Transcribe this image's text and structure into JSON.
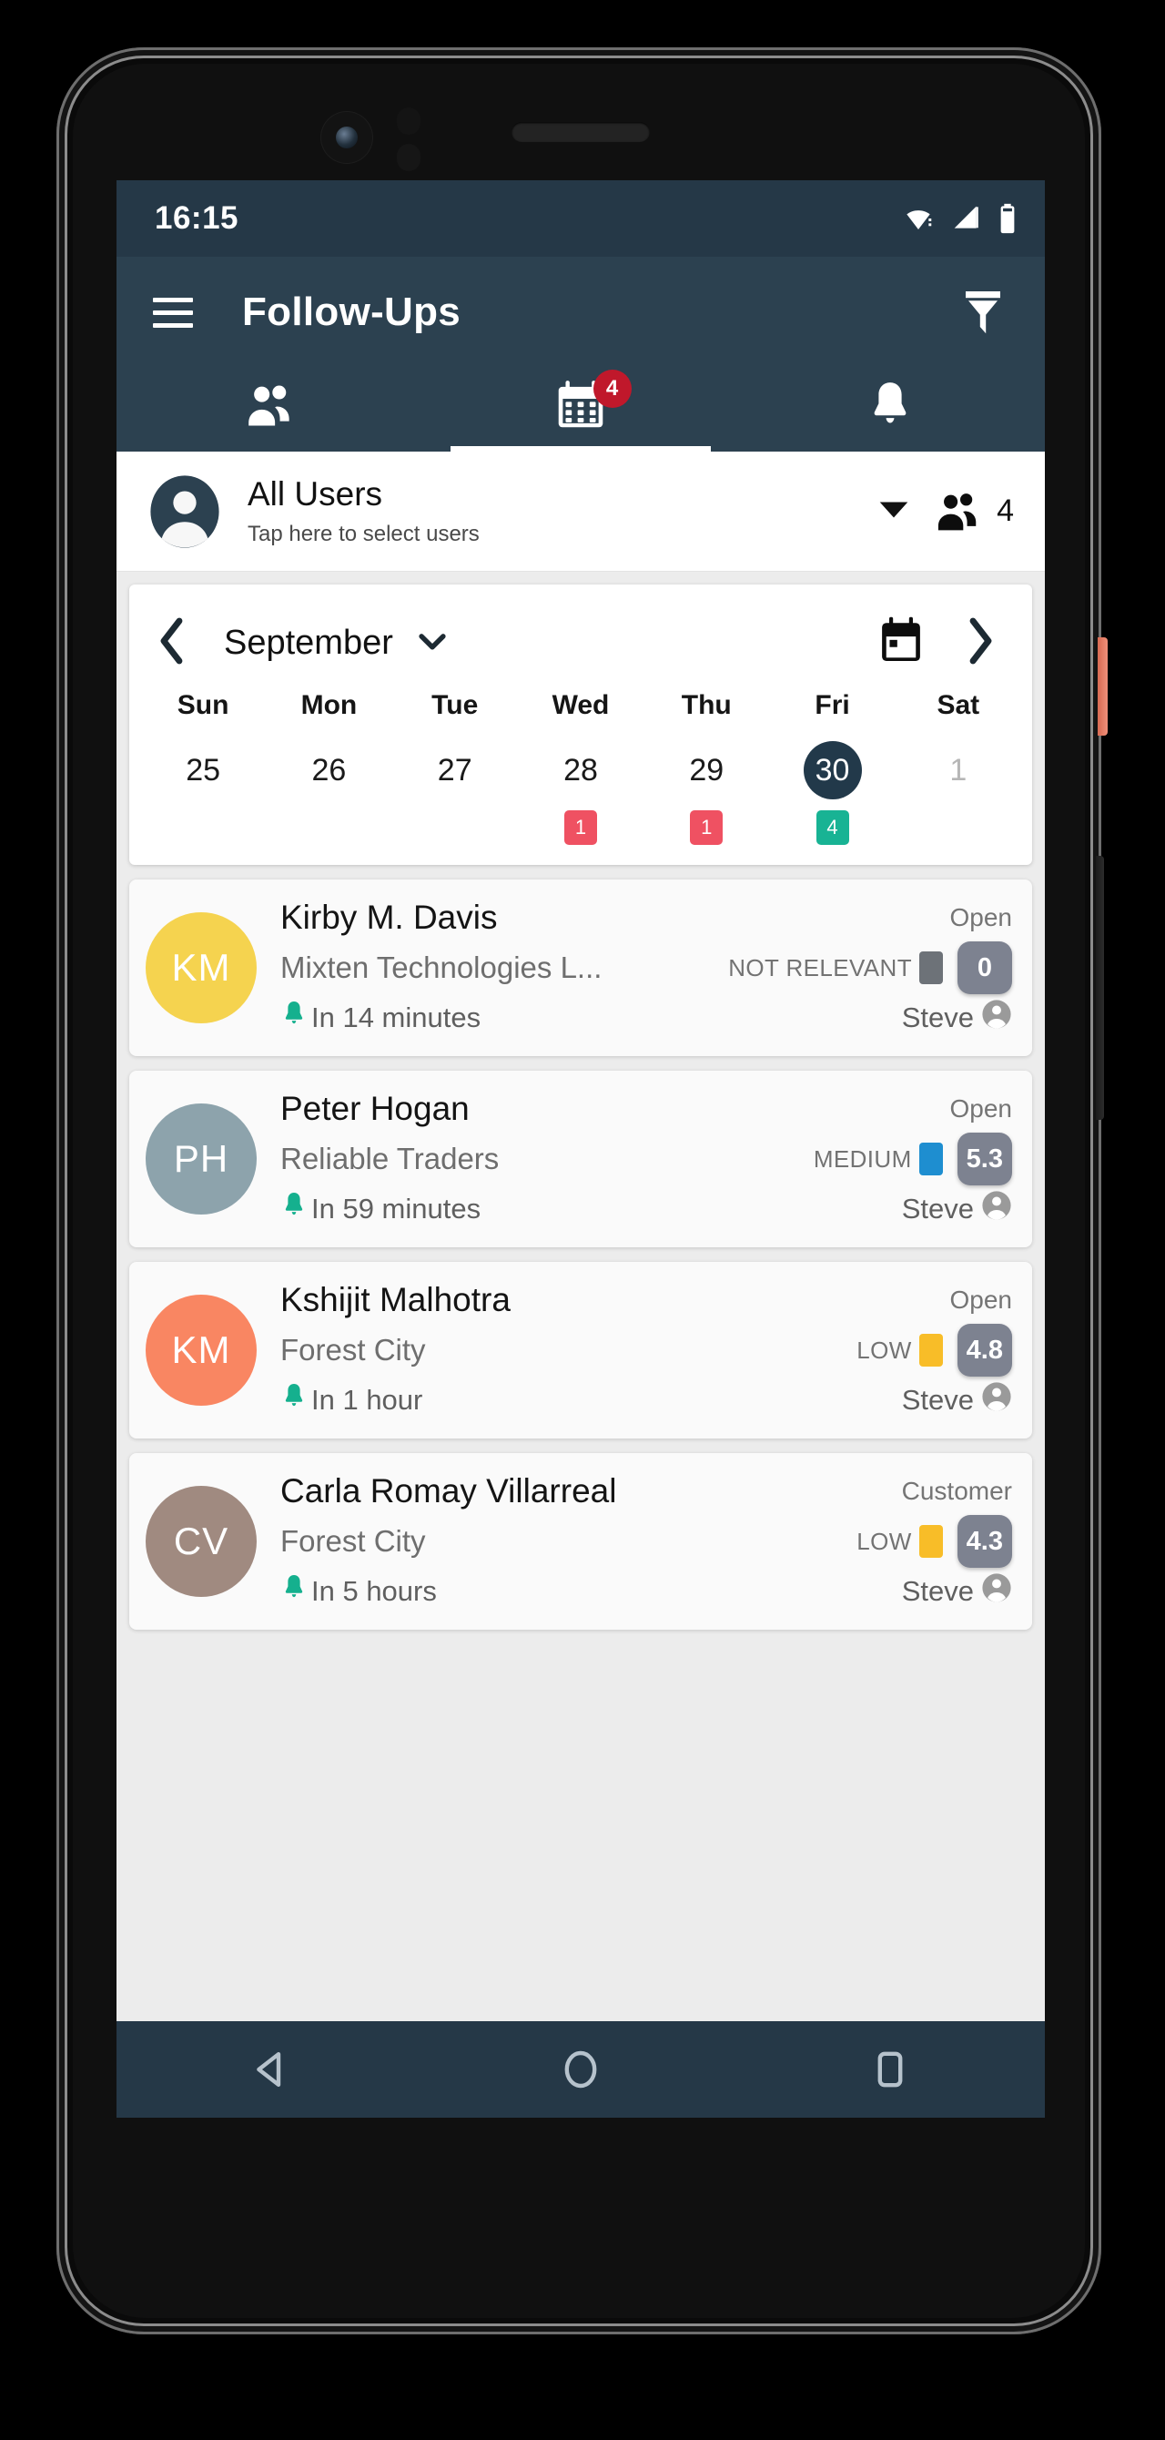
{
  "status_bar": {
    "clock": "16:15",
    "icons": [
      "wifi-icon",
      "signal-icon",
      "battery-icon"
    ]
  },
  "app_bar": {
    "menu_icon": "hamburger-menu-icon",
    "title": "Follow-Ups",
    "filter_icon": "filter-funnel-icon"
  },
  "tabs": [
    {
      "icon": "people-group-icon",
      "badge": "",
      "active": false
    },
    {
      "icon": "calendar-icon",
      "badge": "4",
      "active": true
    },
    {
      "icon": "bell-icon",
      "badge": "",
      "active": false
    }
  ],
  "user_selector": {
    "avatar_icon": "person-circle-icon",
    "name": "All Users",
    "subtitle": "Tap here to select users",
    "caret_icon": "caret-down-icon",
    "group_icon": "people-group-icon",
    "count": "4"
  },
  "calendar": {
    "prev_icon": "chevron-left-icon",
    "month": "September",
    "month_caret_icon": "chevron-down-icon",
    "calendar_icon": "calendar-date-icon",
    "next_icon": "chevron-right-icon",
    "weekdays": [
      "Sun",
      "Mon",
      "Tue",
      "Wed",
      "Thu",
      "Fri",
      "Sat"
    ],
    "days": [
      {
        "date": "25",
        "badge": "",
        "badge_color": "",
        "selected": false,
        "muted": false
      },
      {
        "date": "26",
        "badge": "",
        "badge_color": "",
        "selected": false,
        "muted": false
      },
      {
        "date": "27",
        "badge": "",
        "badge_color": "",
        "selected": false,
        "muted": false
      },
      {
        "date": "28",
        "badge": "1",
        "badge_color": "#ef5162",
        "selected": false,
        "muted": false
      },
      {
        "date": "29",
        "badge": "1",
        "badge_color": "#ef5162",
        "selected": false,
        "muted": false
      },
      {
        "date": "30",
        "badge": "4",
        "badge_color": "#18b394",
        "selected": true,
        "muted": false
      },
      {
        "date": "1",
        "badge": "",
        "badge_color": "",
        "selected": false,
        "muted": true
      }
    ],
    "selected_day_color": "#22394a"
  },
  "followups": [
    {
      "initials": "KM",
      "avatar_color": "#f5d34f",
      "name": "Kirby M. Davis",
      "status": "Open",
      "company": "Mixten Technologies L...",
      "priority": "NOT RELEVANT",
      "priority_color": "#6d7278",
      "score": "0",
      "due": "In 14 minutes",
      "owner": "Steve",
      "bell_icon": "bell-icon",
      "owner_icon": "person-icon"
    },
    {
      "initials": "PH",
      "avatar_color": "#8da3ac",
      "name": "Peter Hogan",
      "status": "Open",
      "company": "Reliable Traders",
      "priority": "MEDIUM",
      "priority_color": "#1e8ed0",
      "score": "5.3",
      "due": "In 59 minutes",
      "owner": "Steve",
      "bell_icon": "bell-icon",
      "owner_icon": "person-icon"
    },
    {
      "initials": "KM",
      "avatar_color": "#f98662",
      "name": "Kshijit Malhotra",
      "status": "Open",
      "company": "Forest City",
      "priority": "LOW",
      "priority_color": "#f8bd28",
      "score": "4.8",
      "due": "In 1 hour",
      "owner": "Steve",
      "bell_icon": "bell-icon",
      "owner_icon": "person-icon"
    },
    {
      "initials": "CV",
      "avatar_color": "#a08a80",
      "name": "Carla Romay Villarreal",
      "status": "Customer",
      "company": "Forest City",
      "priority": "LOW",
      "priority_color": "#f8bd28",
      "score": "4.3",
      "due": "In 5 hours",
      "owner": "Steve",
      "bell_icon": "bell-icon",
      "owner_icon": "person-icon"
    }
  ],
  "nav_bar": {
    "back_icon": "back-triangle-icon",
    "home_icon": "home-circle-icon",
    "recents_icon": "recents-square-icon"
  },
  "theme": {
    "app_bar": "#2c4150",
    "status_bar": "#253847",
    "badge_red": "#c0182b",
    "accent_teal": "#18b394",
    "screen_bg": "#ececec"
  }
}
